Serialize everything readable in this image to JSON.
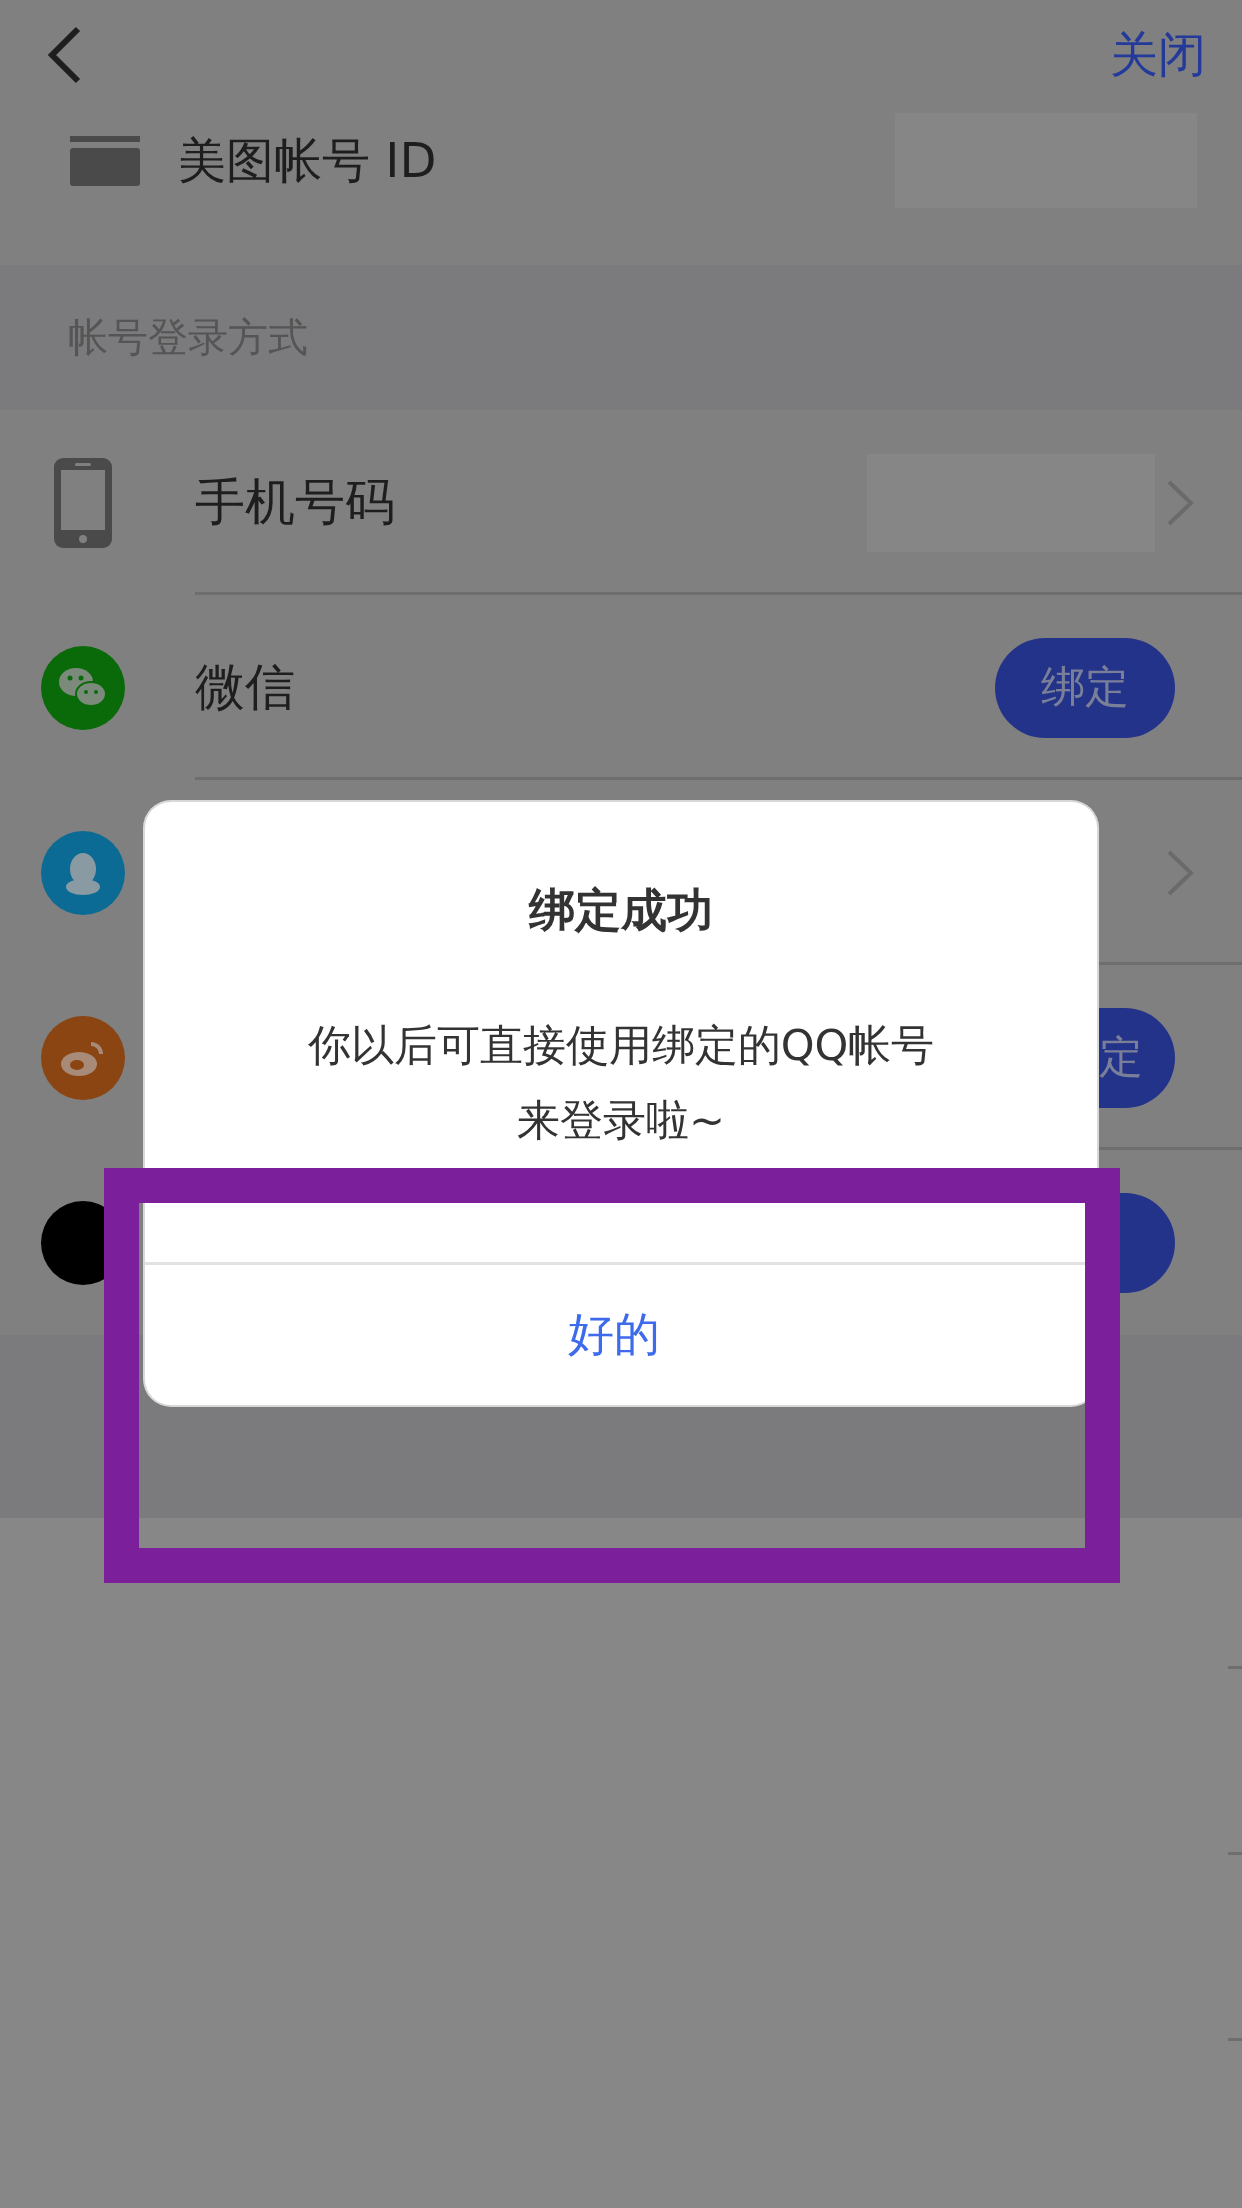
{
  "nav": {
    "close": "关闭"
  },
  "account": {
    "label": "美图帐号 ID",
    "masked": true
  },
  "login_section": {
    "title": "帐号登录方式",
    "rows": [
      {
        "kind": "phone",
        "label": "手机号码",
        "masked": true,
        "chevron": true,
        "bind_button": false
      },
      {
        "kind": "wechat",
        "label": "微信",
        "chevron": false,
        "bind_button": true,
        "button": "绑定"
      },
      {
        "kind": "qq",
        "chevron": true,
        "bind_button": false
      },
      {
        "kind": "weibo",
        "chevron": false,
        "bind_button": true,
        "button": "定"
      },
      {
        "kind": "dark",
        "chevron": false,
        "bind_button": true
      }
    ]
  },
  "dialog": {
    "title": "绑定成功",
    "message": "你以后可直接使用绑定的QQ帐号来登录啦~",
    "button": "好的"
  }
}
